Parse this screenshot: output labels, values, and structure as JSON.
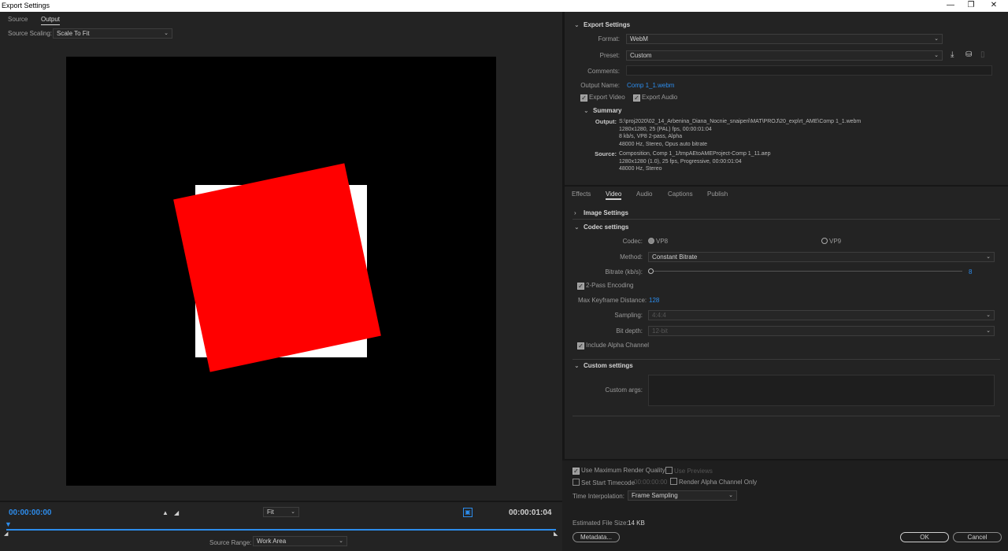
{
  "window": {
    "title": "Export Settings",
    "minimize": "—",
    "restore": "❐",
    "close": "✕"
  },
  "left": {
    "tabs": [
      "Source",
      "Output"
    ],
    "source_scaling_label": "Source Scaling:",
    "source_scaling_value": "Scale To Fit",
    "timecode_start": "00:00:00:00",
    "timecode_end": "00:00:01:04",
    "zoom_value": "Fit",
    "source_range_label": "Source Range:",
    "source_range_value": "Work Area"
  },
  "export_settings": {
    "header": "Export Settings",
    "format_label": "Format:",
    "format_value": "WebM",
    "preset_label": "Preset:",
    "preset_value": "Custom",
    "comments_label": "Comments:",
    "output_name_label": "Output Name:",
    "output_name_value": "Comp 1_1.webm",
    "export_video": "Export Video",
    "export_audio": "Export Audio",
    "summary_header": "Summary",
    "output_label": "Output:",
    "output_lines": [
      "S:\\proj2020\\02_14_Arbenina_Diana_Nocnie_snaiperi\\MAT\\PROJ\\20_exp\\rt_AME\\Comp 1_1.webm",
      "1280x1280, 25 (PAL) fps, 00:00:01:04",
      "8 kb/s, VP8 2-pass, Alpha",
      "48000 Hz, Stereo, Opus auto bitrate"
    ],
    "source_label": "Source:",
    "source_lines": [
      "Composition, Comp 1_1/tmpAEtoAMEProject-Comp 1_11.aep",
      "1280x1280 (1.0), 25 fps, Progressive, 00:00:01:04",
      "48000 Hz, Stereo"
    ]
  },
  "tabs": [
    "Effects",
    "Video",
    "Audio",
    "Captions",
    "Publish"
  ],
  "video": {
    "image_settings": "Image Settings",
    "codec_settings": "Codec settings",
    "codec_label": "Codec:",
    "codec_vp8": "VP8",
    "codec_vp9": "VP9",
    "method_label": "Method:",
    "method_value": "Constant Bitrate",
    "bitrate_label": "Bitrate (kb/s):",
    "bitrate_value": "8",
    "two_pass": "2-Pass Encoding",
    "max_keyframe_label": "Max Keyframe Distance:",
    "max_keyframe_value": "128",
    "sampling_label": "Sampling:",
    "sampling_value": "4:4:4",
    "bit_depth_label": "Bit depth:",
    "bit_depth_value": "12-bit",
    "include_alpha": "Include Alpha Channel",
    "custom_settings": "Custom settings",
    "custom_args_label": "Custom args:"
  },
  "bottom": {
    "max_render_quality": "Use Maximum Render Quality",
    "use_previews": "Use Previews",
    "set_start_timecode": "Set Start Timecode",
    "start_timecode_value": "00:00:00:00",
    "render_alpha_only": "Render Alpha Channel Only",
    "time_interp_label": "Time Interpolation:",
    "time_interp_value": "Frame Sampling",
    "est_size_label": "Estimated File Size:",
    "est_size_value": "14 KB",
    "metadata_button": "Metadata...",
    "ok_button": "OK",
    "cancel_button": "Cancel"
  },
  "colors": {
    "accent": "#2d8ceb",
    "panel": "#232323",
    "red_layer": "#ff0000"
  }
}
